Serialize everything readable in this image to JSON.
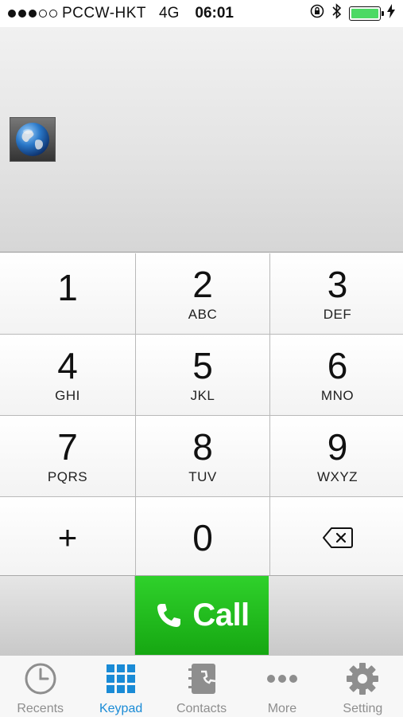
{
  "status_bar": {
    "carrier": "PCCW-HKT",
    "network": "4G",
    "time": "06:01",
    "signal_bars_filled": 3,
    "signal_bars_total": 5,
    "battery_level": 1.0
  },
  "keypad": {
    "keys": [
      {
        "digit": "1",
        "letters": ""
      },
      {
        "digit": "2",
        "letters": "ABC"
      },
      {
        "digit": "3",
        "letters": "DEF"
      },
      {
        "digit": "4",
        "letters": "GHI"
      },
      {
        "digit": "5",
        "letters": "JKL"
      },
      {
        "digit": "6",
        "letters": "MNO"
      },
      {
        "digit": "7",
        "letters": "PQRS"
      },
      {
        "digit": "8",
        "letters": "TUV"
      },
      {
        "digit": "9",
        "letters": "WXYZ"
      }
    ],
    "plus": "+",
    "zero": "0"
  },
  "call": {
    "label": "Call"
  },
  "tabs": [
    {
      "label": "Recents",
      "icon": "clock-icon"
    },
    {
      "label": "Keypad",
      "icon": "keypad-grid-icon"
    },
    {
      "label": "Contacts",
      "icon": "contacts-book-icon"
    },
    {
      "label": "More",
      "icon": "more-dots-icon"
    },
    {
      "label": "Setting",
      "icon": "gear-icon"
    }
  ],
  "colors": {
    "call_green": "#1fbf1a",
    "active_tab": "#1a8bd6",
    "inactive_tab": "#8e8e8e",
    "battery_green": "#4cd964"
  }
}
